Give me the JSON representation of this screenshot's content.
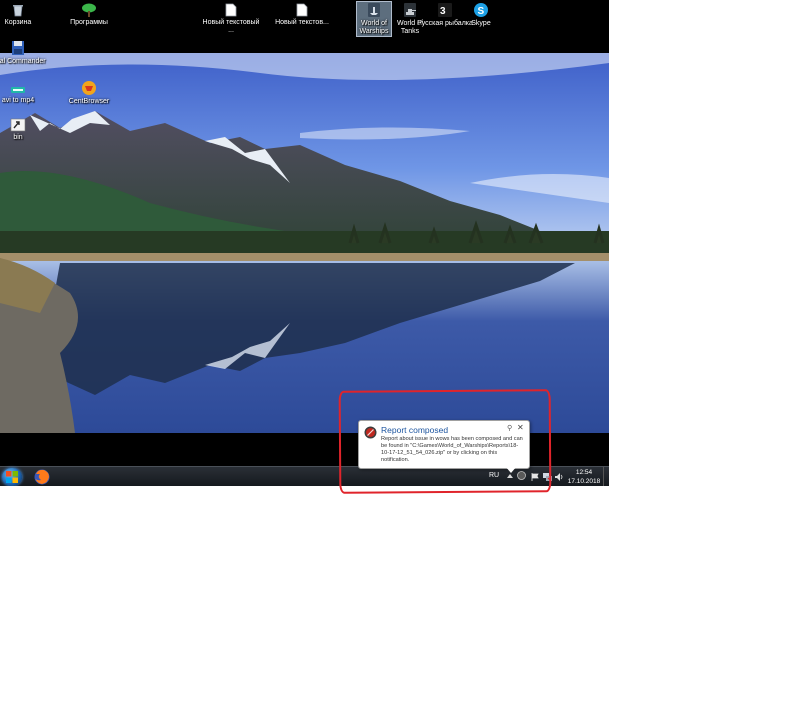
{
  "desktop": {
    "icons": [
      {
        "label": "Корзина",
        "icon": "recycle-bin-icon"
      },
      {
        "label": "Программы",
        "icon": "tree-icon"
      },
      {
        "label": "Новый текстовый ...",
        "icon": "text-file-icon"
      },
      {
        "label": "Новый текстов...",
        "icon": "text-file-icon"
      },
      {
        "label": "World of Warships",
        "icon": "warships-icon"
      },
      {
        "label": "World of Tanks",
        "icon": "tanks-icon"
      },
      {
        "label": "Русская рыбалка",
        "icon": "fishing-icon"
      },
      {
        "label": "Skype",
        "icon": "skype-icon"
      },
      {
        "label": "Total Commander",
        "icon": "floppy-disk-icon"
      },
      {
        "label": "avi to mp4",
        "icon": "converter-icon"
      },
      {
        "label": "CentBrowser",
        "icon": "browser-icon"
      },
      {
        "label": "bin",
        "icon": "shortcut-icon"
      }
    ]
  },
  "taskbar": {
    "pinned": [
      {
        "icon": "firefox-icon"
      }
    ],
    "language": "RU",
    "clock": {
      "time": "12:54",
      "date": "17.10.2018"
    }
  },
  "notification": {
    "title": "Report composed",
    "body": "Report about issue in wows has been composed and can be found in \"C:\\Games\\World_of_Warships\\Reports\\18-10-17-12_51_54_026.zip\" or by clicking on this notification.",
    "pin_glyph": "⚲",
    "close_glyph": "✕"
  },
  "colors": {
    "annotation": "#e0242b",
    "balloon_title": "#1e56a0",
    "taskbar": "#1c2026"
  }
}
